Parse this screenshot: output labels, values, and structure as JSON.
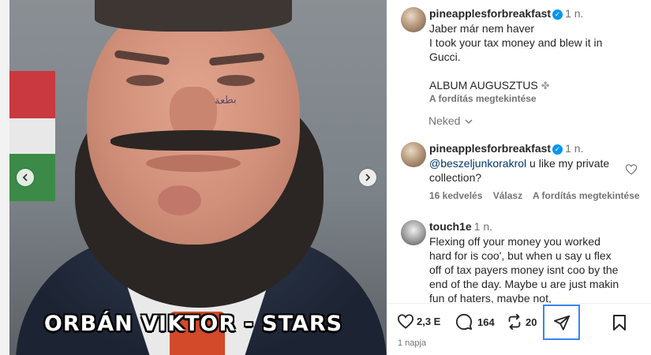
{
  "media": {
    "caption": "ORBÁN VIKTOR - STARS",
    "tattoo_text": "ﺑﻄﻌﺔ",
    "prev_icon": "chevron-left-icon",
    "next_icon": "chevron-right-icon"
  },
  "post": {
    "username": "pineapplesforbreakfast",
    "time": "1 n.",
    "lines": [
      "Jaber már nem haver",
      "I took your tax money and blew it in",
      "Gucci.",
      "",
      "ALBUM AUGUSZTUS"
    ],
    "see_translation": "A fordítás megtekintése",
    "more_label": "Neked"
  },
  "comments": [
    {
      "username": "pineapplesforbreakfast",
      "time": "1 n.",
      "mention": "@beszeljunkorakrol",
      "text": " u like my private collection?",
      "likes": "16 kedvelés",
      "reply": "Válasz",
      "translate": "A fordítás megtekintése"
    },
    {
      "username": "touch1e",
      "time": "1 n.",
      "text": "Flexing off your money you worked hard for is coo', but when u say u flex off of tax payers money isnt coo by the end of the day. Maybe u are just makin fun of haters, maybe not,"
    }
  ],
  "actions": {
    "likes": "2,3 E",
    "comments": "164",
    "reposts": "20",
    "posted_ago": "1 napja"
  },
  "colors": {
    "verified": "#0095f6",
    "share_highlight": "#3b82f6",
    "muted": "#737373",
    "mention": "#00376b"
  }
}
